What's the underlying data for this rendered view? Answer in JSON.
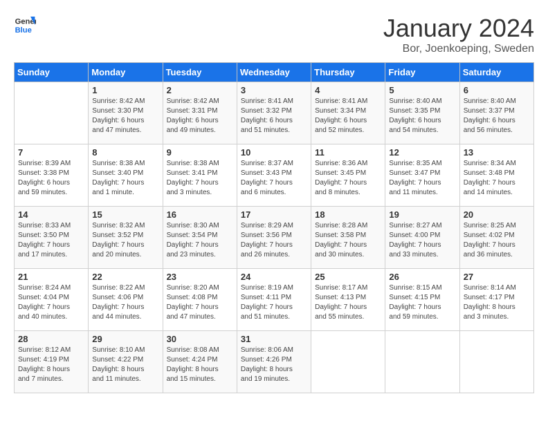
{
  "header": {
    "logo_line1": "General",
    "logo_line2": "Blue",
    "month": "January 2024",
    "location": "Bor, Joenkoeping, Sweden"
  },
  "days_of_week": [
    "Sunday",
    "Monday",
    "Tuesday",
    "Wednesday",
    "Thursday",
    "Friday",
    "Saturday"
  ],
  "weeks": [
    [
      {
        "day": "",
        "info": ""
      },
      {
        "day": "1",
        "info": "Sunrise: 8:42 AM\nSunset: 3:30 PM\nDaylight: 6 hours\nand 47 minutes."
      },
      {
        "day": "2",
        "info": "Sunrise: 8:42 AM\nSunset: 3:31 PM\nDaylight: 6 hours\nand 49 minutes."
      },
      {
        "day": "3",
        "info": "Sunrise: 8:41 AM\nSunset: 3:32 PM\nDaylight: 6 hours\nand 51 minutes."
      },
      {
        "day": "4",
        "info": "Sunrise: 8:41 AM\nSunset: 3:34 PM\nDaylight: 6 hours\nand 52 minutes."
      },
      {
        "day": "5",
        "info": "Sunrise: 8:40 AM\nSunset: 3:35 PM\nDaylight: 6 hours\nand 54 minutes."
      },
      {
        "day": "6",
        "info": "Sunrise: 8:40 AM\nSunset: 3:37 PM\nDaylight: 6 hours\nand 56 minutes."
      }
    ],
    [
      {
        "day": "7",
        "info": "Sunrise: 8:39 AM\nSunset: 3:38 PM\nDaylight: 6 hours\nand 59 minutes."
      },
      {
        "day": "8",
        "info": "Sunrise: 8:38 AM\nSunset: 3:40 PM\nDaylight: 7 hours\nand 1 minute."
      },
      {
        "day": "9",
        "info": "Sunrise: 8:38 AM\nSunset: 3:41 PM\nDaylight: 7 hours\nand 3 minutes."
      },
      {
        "day": "10",
        "info": "Sunrise: 8:37 AM\nSunset: 3:43 PM\nDaylight: 7 hours\nand 6 minutes."
      },
      {
        "day": "11",
        "info": "Sunrise: 8:36 AM\nSunset: 3:45 PM\nDaylight: 7 hours\nand 8 minutes."
      },
      {
        "day": "12",
        "info": "Sunrise: 8:35 AM\nSunset: 3:47 PM\nDaylight: 7 hours\nand 11 minutes."
      },
      {
        "day": "13",
        "info": "Sunrise: 8:34 AM\nSunset: 3:48 PM\nDaylight: 7 hours\nand 14 minutes."
      }
    ],
    [
      {
        "day": "14",
        "info": "Sunrise: 8:33 AM\nSunset: 3:50 PM\nDaylight: 7 hours\nand 17 minutes."
      },
      {
        "day": "15",
        "info": "Sunrise: 8:32 AM\nSunset: 3:52 PM\nDaylight: 7 hours\nand 20 minutes."
      },
      {
        "day": "16",
        "info": "Sunrise: 8:30 AM\nSunset: 3:54 PM\nDaylight: 7 hours\nand 23 minutes."
      },
      {
        "day": "17",
        "info": "Sunrise: 8:29 AM\nSunset: 3:56 PM\nDaylight: 7 hours\nand 26 minutes."
      },
      {
        "day": "18",
        "info": "Sunrise: 8:28 AM\nSunset: 3:58 PM\nDaylight: 7 hours\nand 30 minutes."
      },
      {
        "day": "19",
        "info": "Sunrise: 8:27 AM\nSunset: 4:00 PM\nDaylight: 7 hours\nand 33 minutes."
      },
      {
        "day": "20",
        "info": "Sunrise: 8:25 AM\nSunset: 4:02 PM\nDaylight: 7 hours\nand 36 minutes."
      }
    ],
    [
      {
        "day": "21",
        "info": "Sunrise: 8:24 AM\nSunset: 4:04 PM\nDaylight: 7 hours\nand 40 minutes."
      },
      {
        "day": "22",
        "info": "Sunrise: 8:22 AM\nSunset: 4:06 PM\nDaylight: 7 hours\nand 44 minutes."
      },
      {
        "day": "23",
        "info": "Sunrise: 8:20 AM\nSunset: 4:08 PM\nDaylight: 7 hours\nand 47 minutes."
      },
      {
        "day": "24",
        "info": "Sunrise: 8:19 AM\nSunset: 4:11 PM\nDaylight: 7 hours\nand 51 minutes."
      },
      {
        "day": "25",
        "info": "Sunrise: 8:17 AM\nSunset: 4:13 PM\nDaylight: 7 hours\nand 55 minutes."
      },
      {
        "day": "26",
        "info": "Sunrise: 8:15 AM\nSunset: 4:15 PM\nDaylight: 7 hours\nand 59 minutes."
      },
      {
        "day": "27",
        "info": "Sunrise: 8:14 AM\nSunset: 4:17 PM\nDaylight: 8 hours\nand 3 minutes."
      }
    ],
    [
      {
        "day": "28",
        "info": "Sunrise: 8:12 AM\nSunset: 4:19 PM\nDaylight: 8 hours\nand 7 minutes."
      },
      {
        "day": "29",
        "info": "Sunrise: 8:10 AM\nSunset: 4:22 PM\nDaylight: 8 hours\nand 11 minutes."
      },
      {
        "day": "30",
        "info": "Sunrise: 8:08 AM\nSunset: 4:24 PM\nDaylight: 8 hours\nand 15 minutes."
      },
      {
        "day": "31",
        "info": "Sunrise: 8:06 AM\nSunset: 4:26 PM\nDaylight: 8 hours\nand 19 minutes."
      },
      {
        "day": "",
        "info": ""
      },
      {
        "day": "",
        "info": ""
      },
      {
        "day": "",
        "info": ""
      }
    ]
  ]
}
